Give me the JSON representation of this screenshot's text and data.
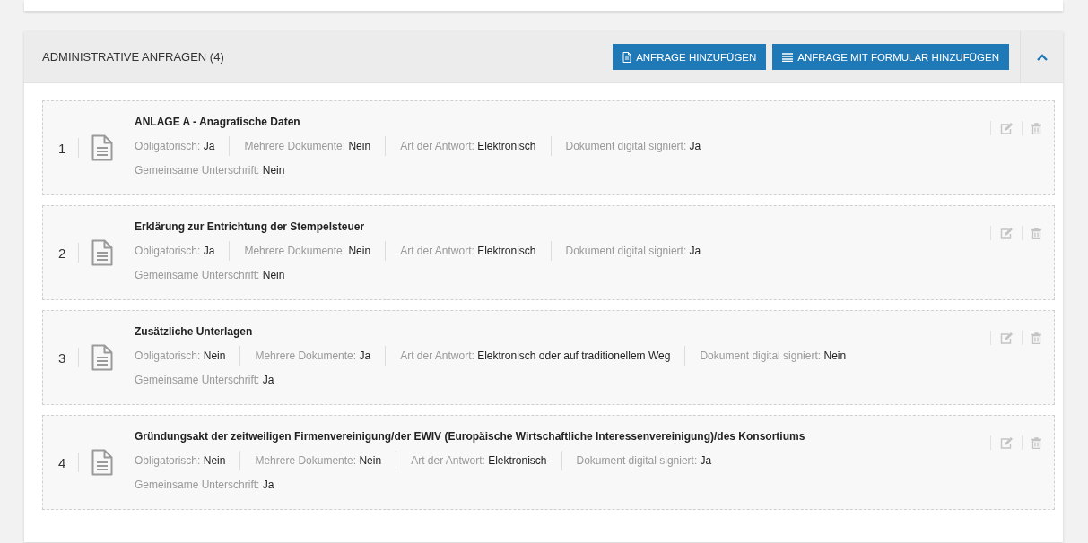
{
  "panel": {
    "title": "ADMINISTRATIVE ANFRAGEN (4)",
    "buttons": [
      {
        "kind": "file",
        "label": "ANFRAGE HINZUFÜGEN"
      },
      {
        "kind": "list",
        "label": "ANFRAGE MIT FORMULAR HINZUFÜGEN"
      }
    ],
    "expanded": true
  },
  "requests": [
    {
      "number": "1",
      "title": "ANLAGE A - Anagrafische Daten",
      "fields": [
        {
          "label": "Obligatorisch:",
          "value": "Ja"
        },
        {
          "label": "Mehrere Dokumente:",
          "value": "Nein"
        },
        {
          "label": "Art der Antwort:",
          "value": "Elektronisch"
        },
        {
          "label": "Dokument digital signiert:",
          "value": "Ja"
        }
      ],
      "extra_field": {
        "label": "Gemeinsame Unterschrift:",
        "value": "Nein"
      }
    },
    {
      "number": "2",
      "title": "Erklärung zur Entrichtung der Stempelsteuer",
      "fields": [
        {
          "label": "Obligatorisch:",
          "value": "Ja"
        },
        {
          "label": "Mehrere Dokumente:",
          "value": "Nein"
        },
        {
          "label": "Art der Antwort:",
          "value": "Elektronisch"
        },
        {
          "label": "Dokument digital signiert:",
          "value": "Ja"
        }
      ],
      "extra_field": {
        "label": "Gemeinsame Unterschrift:",
        "value": "Nein"
      }
    },
    {
      "number": "3",
      "title": "Zusätzliche Unterlagen",
      "fields": [
        {
          "label": "Obligatorisch:",
          "value": "Nein"
        },
        {
          "label": "Mehrere Dokumente:",
          "value": "Ja"
        },
        {
          "label": "Art der Antwort:",
          "value": "Elektronisch oder auf traditionellem Weg"
        },
        {
          "label": "Dokument digital signiert:",
          "value": "Nein"
        }
      ],
      "extra_field": {
        "label": "Gemeinsame Unterschrift:",
        "value": "Ja"
      }
    },
    {
      "number": "4",
      "title": "Gründungsakt der zeitweiligen Firmenvereinigung/der EWIV (Europäische Wirtschaftliche Interessenvereinigung)/des Konsortiums",
      "fields": [
        {
          "label": "Obligatorisch:",
          "value": "Nein"
        },
        {
          "label": "Mehrere Dokumente:",
          "value": "Nein"
        },
        {
          "label": "Art der Antwort:",
          "value": "Elektronisch"
        },
        {
          "label": "Dokument digital signiert:",
          "value": "Ja"
        }
      ],
      "extra_field": {
        "label": "Gemeinsame Unterschrift:",
        "value": "Ja"
      }
    }
  ]
}
